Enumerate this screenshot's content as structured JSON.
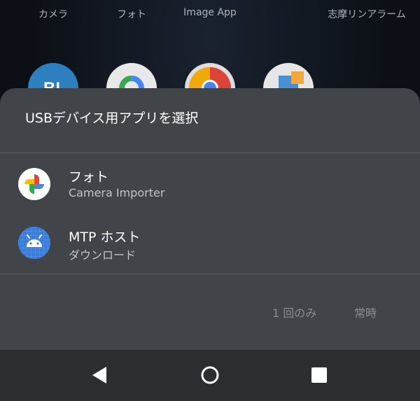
{
  "home": {
    "labels": [
      "カメラ",
      "フォト",
      "Image App",
      "志摩リンアラーム"
    ],
    "icons": [
      "blue-app-icon",
      "google-photos-icon",
      "chrome-icon",
      "image-app-icon"
    ]
  },
  "dialog": {
    "title": "USBデバイス用アプリを選択",
    "options": [
      {
        "title": "フォト",
        "subtitle": "Camera Importer",
        "icon": "google-photos-icon"
      },
      {
        "title": "MTP ホスト",
        "subtitle": "ダウンロード",
        "icon": "android-icon"
      }
    ],
    "buttons": {
      "once": "1 回のみ",
      "always": "常時"
    }
  },
  "navbar": {
    "icons": [
      "back-icon",
      "home-icon",
      "recents-icon"
    ]
  },
  "colors": {
    "sheet": "#414448",
    "navbar": "#2b2d31",
    "android_blue": "#3b7ddd"
  }
}
